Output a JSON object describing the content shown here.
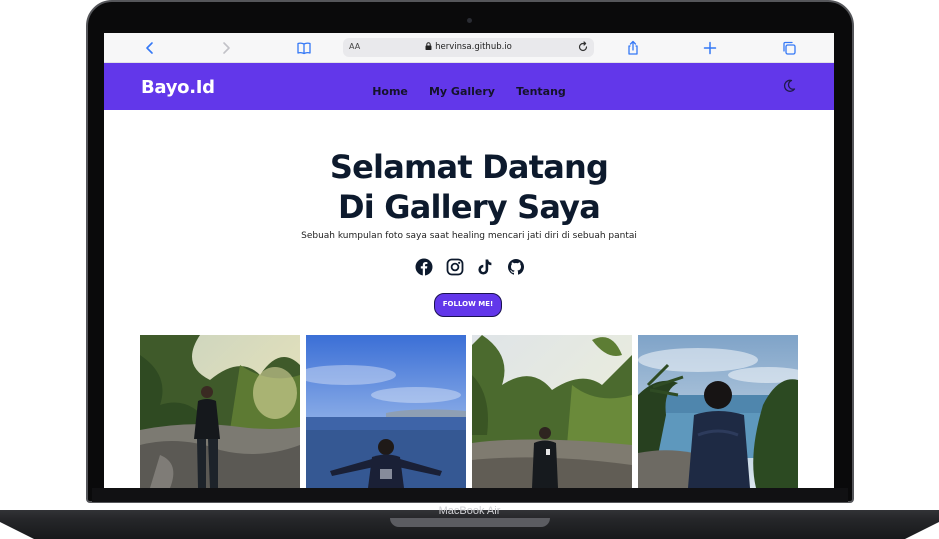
{
  "device": {
    "brand_label": "MacBook Air"
  },
  "browser": {
    "text_size_label": "AA",
    "url": "hervinsa.github.io",
    "icons": [
      "back-icon",
      "forward-icon",
      "bookmarks-icon",
      "lock-icon",
      "reload-icon",
      "share-icon",
      "new-tab-icon",
      "tabs-icon"
    ]
  },
  "navbar": {
    "logo": "Bayo.Id",
    "links": [
      "Home",
      "My Gallery",
      "Tentang"
    ],
    "theme_icon": "moon-icon",
    "background": "#6237ea"
  },
  "hero": {
    "title_line1": "Selamat Datang",
    "title_line2": "Di Gallery Saya",
    "subtitle": "Sebuah kumpulan foto saya saat healing mencari jati diri di sebuah pantai",
    "socials": [
      "facebook-icon",
      "instagram-icon",
      "tiktok-icon",
      "github-icon"
    ],
    "cta_label": "FOLLOW ME!"
  },
  "gallery": {
    "photos": [
      "gallery-photo-1",
      "gallery-photo-2",
      "gallery-photo-3",
      "gallery-photo-4"
    ]
  }
}
